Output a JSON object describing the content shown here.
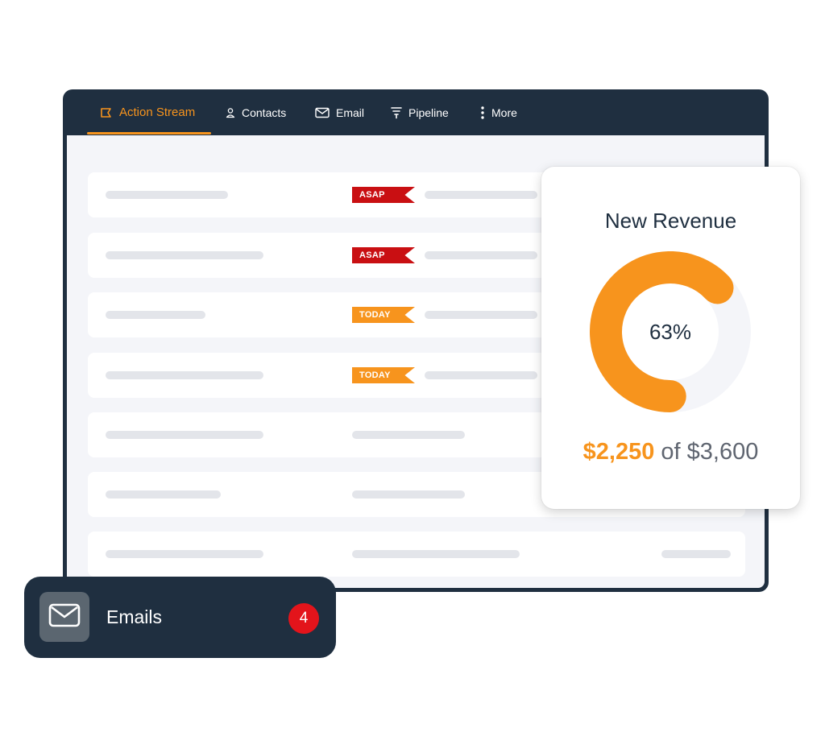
{
  "nav": {
    "items": [
      {
        "label": "Action Stream",
        "icon": "action-stream-icon",
        "active": true
      },
      {
        "label": "Contacts",
        "icon": "contacts-icon",
        "active": false
      },
      {
        "label": "Email",
        "icon": "email-icon",
        "active": false
      },
      {
        "label": "Pipeline",
        "icon": "pipeline-icon",
        "active": false
      },
      {
        "label": "More",
        "icon": "more-vertical-icon",
        "active": false
      }
    ]
  },
  "tasks": {
    "rows": [
      {
        "priority": "ASAP"
      },
      {
        "priority": "ASAP"
      },
      {
        "priority": "TODAY"
      },
      {
        "priority": "TODAY"
      }
    ]
  },
  "revenue": {
    "title": "New Revenue",
    "percent": 63,
    "percent_label": "63%",
    "current": "$2,250",
    "separator": "of",
    "total": "$3,600"
  },
  "emails": {
    "label": "Emails",
    "count": "4"
  },
  "colors": {
    "navy": "#1f2f40",
    "accent": "#f7941d",
    "asap": "#c90f12",
    "badge": "#e3141b",
    "placeholder": "#e3e5ea"
  }
}
